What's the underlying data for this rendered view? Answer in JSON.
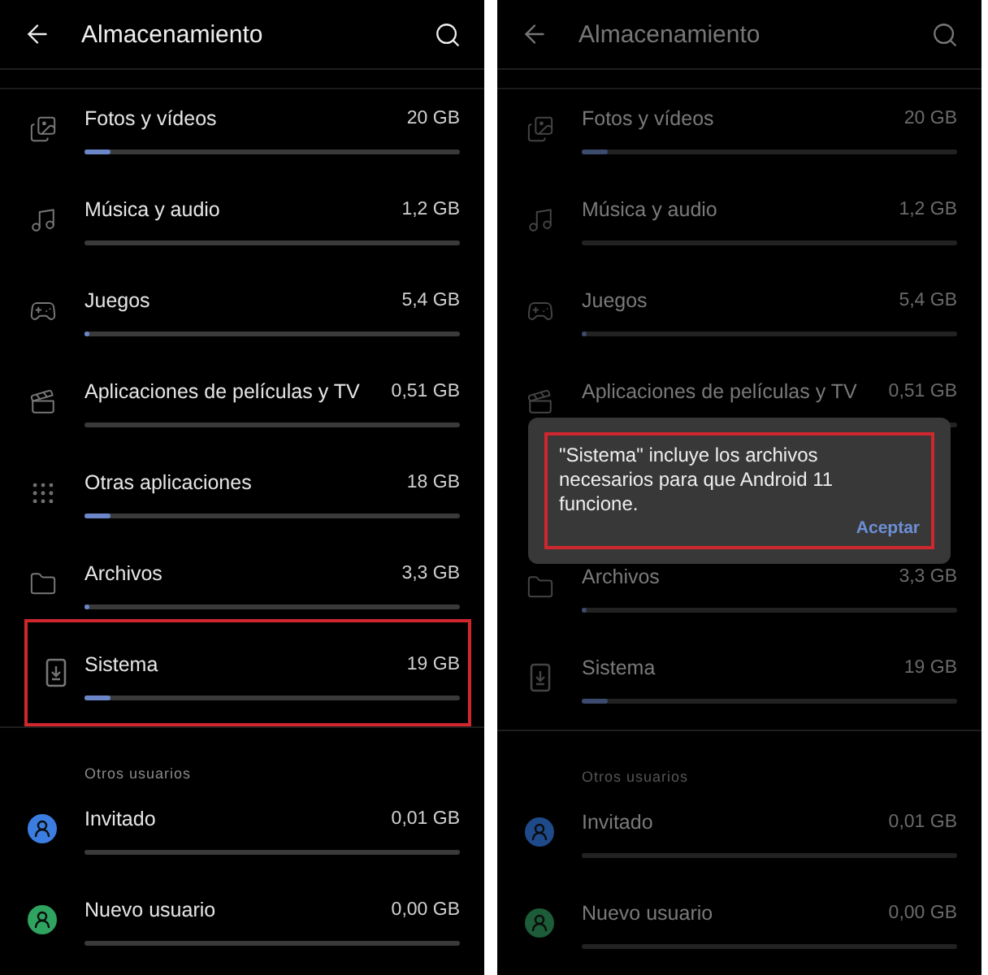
{
  "screens": [
    {
      "dimmed": false,
      "title": "Almacenamiento",
      "categories": [
        {
          "kind": "photos",
          "name": "Fotos y vídeos",
          "size": "20 GB",
          "level": 0.07,
          "highlighted": false
        },
        {
          "kind": "music",
          "name": "Música y audio",
          "size": "1,2 GB",
          "highlighted": false
        },
        {
          "kind": "games",
          "name": "Juegos",
          "size": "5,4 GB",
          "level": 0.01,
          "highlighted": false
        },
        {
          "kind": "movies",
          "name": "Aplicaciones de películas y TV",
          "size": "0,51 GB",
          "highlighted": false
        },
        {
          "kind": "apps",
          "name": "Otras aplicaciones",
          "size": "18 GB",
          "level": 0.07,
          "highlighted": false
        },
        {
          "kind": "files",
          "name": "Archivos",
          "size": "3,3 GB",
          "level": 0.01,
          "highlighted": false
        },
        {
          "kind": "system",
          "name": "Sistema",
          "size": "19 GB",
          "level": 0.07,
          "highlighted": true
        }
      ],
      "section": "Otros usuarios",
      "users": [
        {
          "name": "Invitado",
          "size": "0,01 GB",
          "color": "#3b7de0"
        },
        {
          "name": "Nuevo usuario",
          "size": "0,00 GB",
          "color": "#2fa360"
        }
      ]
    },
    {
      "dimmed": true,
      "title": "Almacenamiento",
      "categories": [
        {
          "kind": "photos",
          "name": "Fotos y vídeos",
          "size": "20 GB",
          "level": 0.07,
          "highlighted": false
        },
        {
          "kind": "music",
          "name": "Música y audio",
          "size": "1,2 GB",
          "highlighted": false
        },
        {
          "kind": "games",
          "name": "Juegos",
          "size": "5,4 GB",
          "level": 0.01,
          "highlighted": false
        },
        {
          "kind": "movies",
          "name": "Aplicaciones de películas y TV",
          "size": "0,51 GB",
          "highlighted": false
        },
        {
          "kind": "dialog",
          "message": "\"Sistema\" incluye los archivos necesarios para que Android 11 funcione.",
          "button": "Aceptar",
          "highlighted": true
        },
        {
          "kind": "files",
          "name": "Archivos",
          "size": "3,3 GB",
          "level": 0.01,
          "highlighted": false
        },
        {
          "kind": "system",
          "name": "Sistema",
          "size": "19 GB",
          "level": 0.07,
          "highlighted": false
        }
      ],
      "section": "Otros usuarios",
      "users": [
        {
          "name": "Invitado",
          "size": "0,01 GB",
          "color": "#1f4a8a"
        },
        {
          "name": "Nuevo usuario",
          "size": "0,00 GB",
          "color": "#1d5c38"
        }
      ]
    }
  ]
}
